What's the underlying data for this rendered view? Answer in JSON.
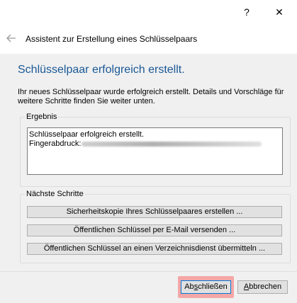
{
  "window": {
    "help_label": "?",
    "close_label": "✕",
    "back_icon": "back-arrow-icon",
    "wizard_title": "Assistent zur Erstellung eines Schlüsselpaars"
  },
  "page": {
    "heading": "Schlüsselpaar erfolgreich erstellt.",
    "description": "Ihr neues Schlüsselpaar wurde erfolgreich erstellt. Details und Vorschläge für weitere Schritte finden Sie weiter unten."
  },
  "result": {
    "legend": "Ergebnis",
    "line1": "Schlüsselpaar erfolgreich erstellt.",
    "fingerprint_label": "Fingerabdruck:"
  },
  "next_steps": {
    "legend": "Nächste Schritte",
    "buttons": [
      "Sicherheitskopie Ihres Schlüsselpaares erstellen ...",
      "Öffentlichen Schlüssel per E-Mail versenden ...",
      "Öffentlichen Schlüssel an einen Verzeichnisdienst übermitteln ..."
    ]
  },
  "footer": {
    "finish_pre": "Ab",
    "finish_underline": "s",
    "finish_post": "chließen",
    "cancel_underline": "A",
    "cancel_post": "bbrechen"
  },
  "colors": {
    "heading": "#1a5896",
    "highlight": "#f4a7a7",
    "focus_border": "#0078d7"
  }
}
